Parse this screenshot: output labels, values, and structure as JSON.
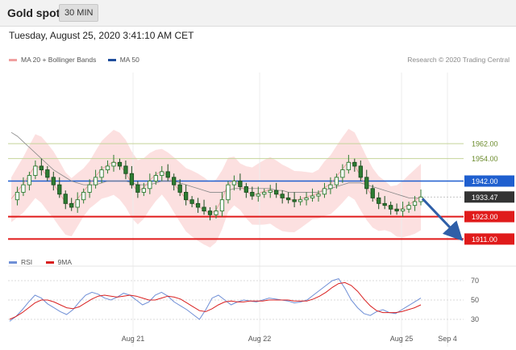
{
  "header": {
    "title": "Gold spot",
    "timeframe": "30 MIN"
  },
  "timestamp": "Tuesday, August 25, 2020 3:41:10 AM CET",
  "legend_price": [
    {
      "label": "MA 20 + Bollinger Bands",
      "color": "#f0a0a0"
    },
    {
      "label": "MA 50",
      "color": "#1f4e9c"
    }
  ],
  "credit": "Research © 2020 Trading Central",
  "legend_rsi": [
    {
      "label": "RSI",
      "color": "#6f8fd6"
    },
    {
      "label": "9MA",
      "color": "#d92020"
    }
  ],
  "colors": {
    "support": "#e01b1b",
    "resistance_line": "#1f5fcf",
    "resistance_minor": "#b9c98a",
    "last_price": "#333333",
    "forecast_arrow": "#2f5fa8",
    "candle": "#2e7d32"
  },
  "chart_data": {
    "type": "candlestick",
    "x_labels": [
      "Aug 21",
      "Aug 22",
      "Aug 25",
      "Sep 4"
    ],
    "ylim": [
      1906,
      2000
    ],
    "levels": [
      {
        "label": "1962.00",
        "value": 1962,
        "kind": "resistance-minor"
      },
      {
        "label": "1954.00",
        "value": 1954,
        "kind": "resistance-minor"
      },
      {
        "label": "1942.00",
        "value": 1942,
        "kind": "resistance"
      },
      {
        "label": "1933.47",
        "value": 1933.47,
        "kind": "last-price"
      },
      {
        "label": "1923.00",
        "value": 1923,
        "kind": "support"
      },
      {
        "label": "1911.00",
        "value": 1911,
        "kind": "support"
      }
    ],
    "price_series": [
      1932,
      1936,
      1940,
      1945,
      1950,
      1948,
      1944,
      1940,
      1935,
      1930,
      1928,
      1932,
      1936,
      1940,
      1944,
      1948,
      1950,
      1952,
      1950,
      1946,
      1940,
      1936,
      1938,
      1942,
      1945,
      1947,
      1944,
      1940,
      1936,
      1932,
      1930,
      1928,
      1926,
      1924,
      1926,
      1932,
      1940,
      1942,
      1939,
      1936,
      1934,
      1935,
      1936,
      1937,
      1935,
      1933,
      1932,
      1931,
      1932,
      1933,
      1934,
      1935,
      1938,
      1940,
      1944,
      1948,
      1952,
      1950,
      1944,
      1938,
      1933,
      1930,
      1929,
      1927,
      1926,
      1927,
      1929,
      1931,
      1933.47
    ],
    "ma50": [
      1968,
      1966,
      1963,
      1960,
      1957,
      1954,
      1951,
      1948,
      1946,
      1944,
      1942,
      1941,
      1940,
      1940,
      1940,
      1941,
      1942,
      1942,
      1942,
      1942,
      1941,
      1940,
      1940,
      1940,
      1941,
      1942,
      1942,
      1942,
      1941,
      1940,
      1939,
      1938,
      1937,
      1936,
      1936,
      1936,
      1937,
      1938,
      1938,
      1938,
      1938,
      1938,
      1938,
      1938,
      1937,
      1937,
      1936,
      1936,
      1936,
      1936,
      1936,
      1936,
      1937,
      1938,
      1939,
      1940,
      1941,
      1941,
      1941,
      1940,
      1939,
      1938,
      1937,
      1936,
      1935,
      1934,
      1933,
      1933,
      1933
    ],
    "rsi": {
      "ylim": [
        20,
        80
      ],
      "ticks": [
        "70",
        "50",
        "30"
      ],
      "tick_values": [
        70,
        50,
        30
      ],
      "rsi_values": [
        28,
        33,
        40,
        48,
        55,
        52,
        46,
        42,
        38,
        35,
        40,
        48,
        55,
        58,
        56,
        52,
        50,
        53,
        57,
        55,
        50,
        45,
        48,
        55,
        58,
        54,
        48,
        44,
        40,
        35,
        30,
        40,
        52,
        55,
        50,
        45,
        48,
        50,
        49,
        48,
        50,
        52,
        51,
        50,
        49,
        47,
        48,
        50,
        55,
        60,
        65,
        70,
        72,
        62,
        50,
        42,
        36,
        34,
        38,
        40,
        37,
        36,
        40,
        44,
        48,
        52
      ],
      "ma_values": [
        30,
        33,
        37,
        42,
        47,
        50,
        50,
        48,
        45,
        42,
        41,
        43,
        47,
        51,
        54,
        55,
        54,
        53,
        54,
        55,
        54,
        52,
        50,
        50,
        52,
        54,
        53,
        51,
        47,
        43,
        39,
        38,
        41,
        45,
        48,
        49,
        48,
        48,
        49,
        49,
        49,
        50,
        50,
        50,
        50,
        49,
        49,
        49,
        51,
        54,
        58,
        63,
        67,
        68,
        65,
        59,
        51,
        44,
        39,
        37,
        37,
        37,
        38,
        40,
        42,
        45
      ]
    }
  }
}
